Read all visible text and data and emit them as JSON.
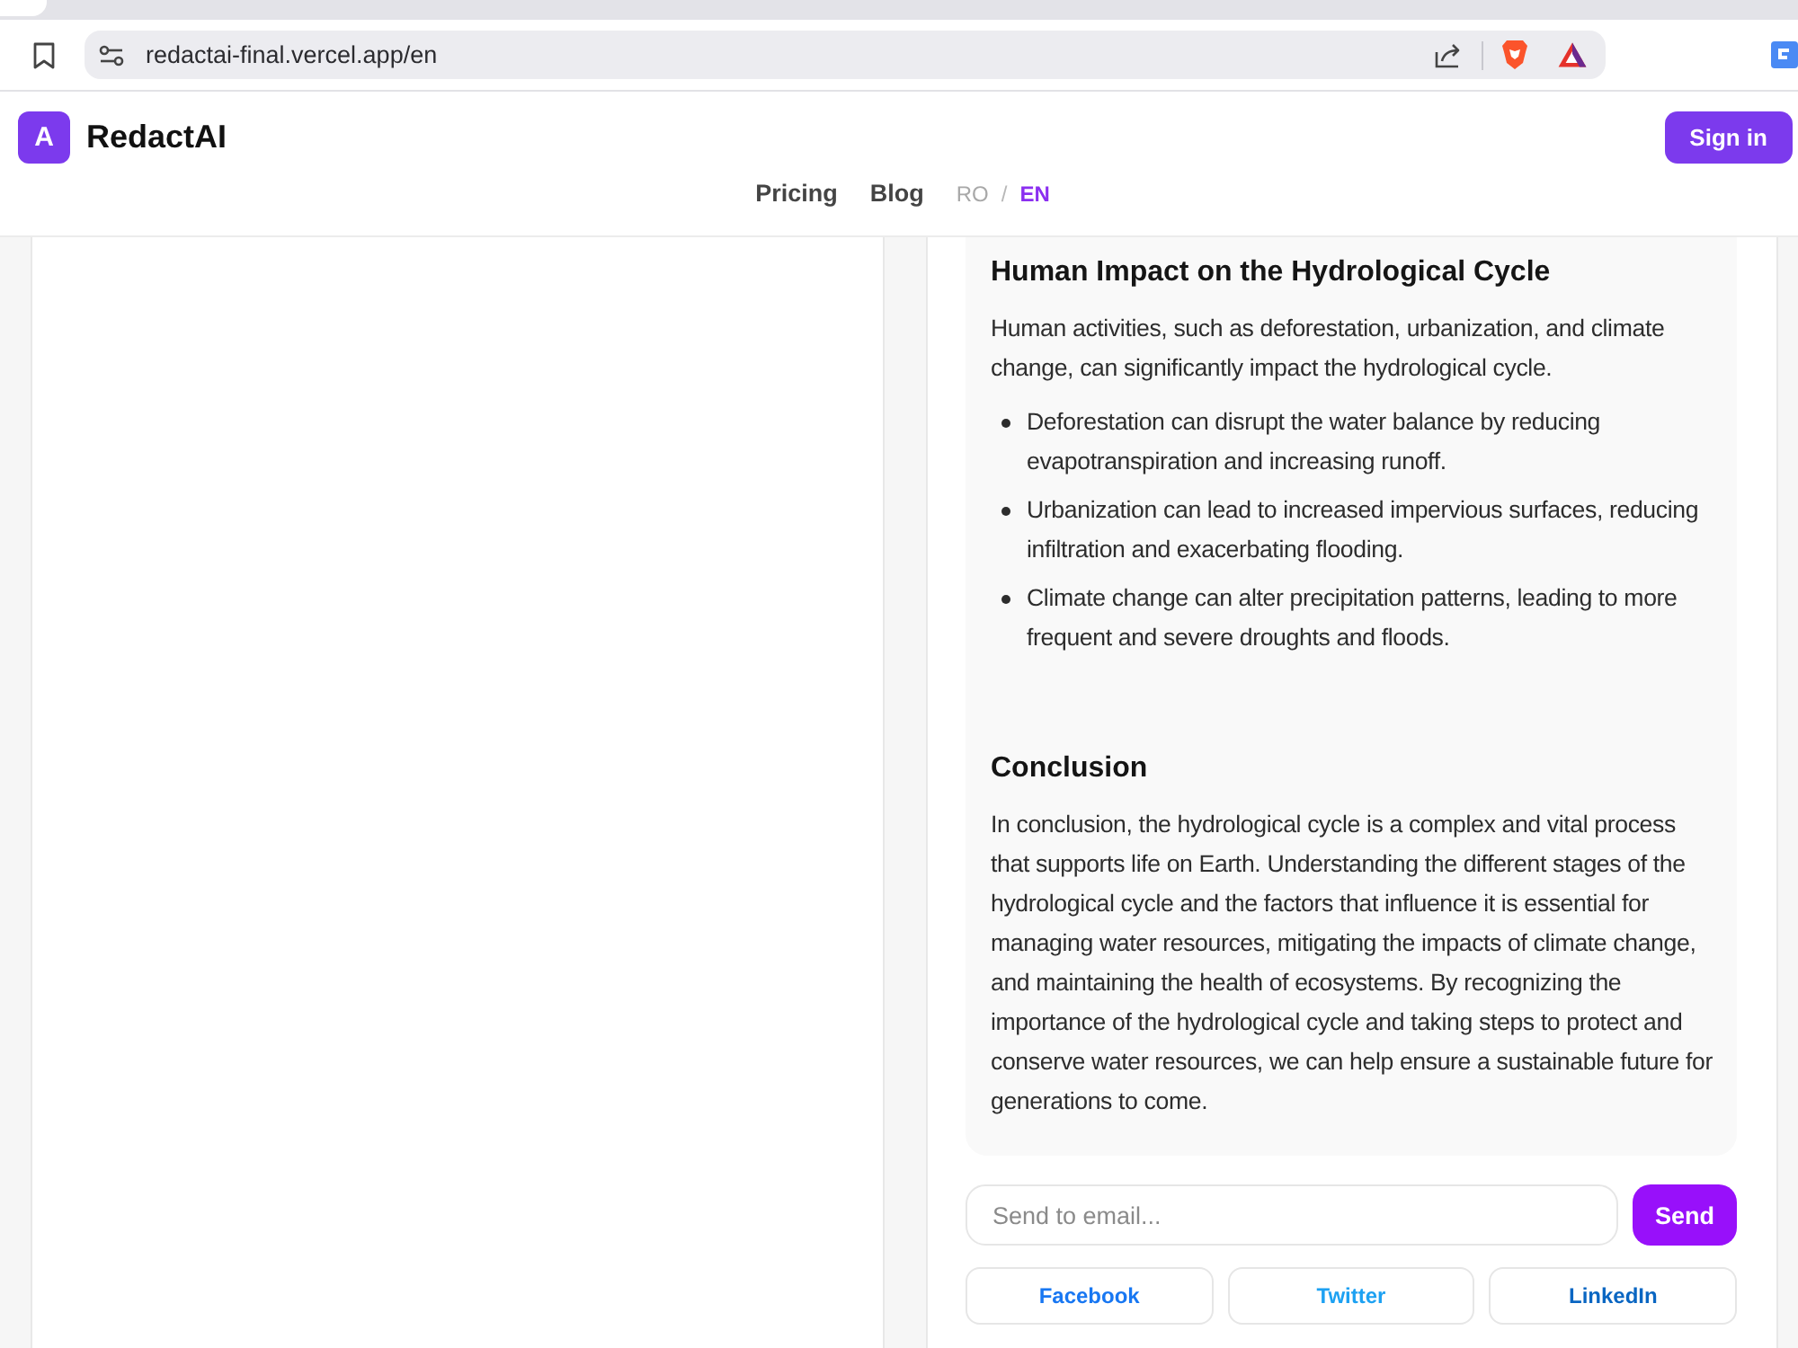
{
  "browser": {
    "url": "redactai-final.vercel.app/en"
  },
  "header": {
    "logo_letter": "A",
    "brand": "RedactAI",
    "sign_in": "Sign in",
    "nav": [
      {
        "label": "Pricing"
      },
      {
        "label": "Blog"
      }
    ],
    "languages": [
      {
        "label": "RO",
        "selected": false
      },
      {
        "label": "EN",
        "selected": true
      }
    ],
    "language_separator": "/"
  },
  "article": {
    "sections": [
      {
        "heading": "Human Impact on the Hydrological Cycle",
        "paragraph": "Human activities, such as deforestation, urbanization, and climate change, can significantly impact the hydrological cycle.",
        "bullets": [
          "Deforestation can disrupt the water balance by reducing evapotranspiration and increasing runoff.",
          "Urbanization can lead to increased impervious surfaces, reducing infiltration and exacerbating flooding.",
          "Climate change can alter precipitation patterns, leading to more frequent and severe droughts and floods."
        ]
      },
      {
        "heading": "Conclusion",
        "paragraph": "In conclusion, the hydrological cycle is a complex and vital process that supports life on Earth. Understanding the different stages of the hydrological cycle and the factors that influence it is essential for managing water resources, mitigating the impacts of climate change, and maintaining the health of ecosystems. By recognizing the importance of the hydrological cycle and taking steps to protect and conserve water resources, we can help ensure a sustainable future for generations to come."
      }
    ]
  },
  "share": {
    "email_placeholder": "Send to email...",
    "send": "Send",
    "social": [
      {
        "label": "Facebook",
        "color": "#1877f2"
      },
      {
        "label": "Twitter",
        "color": "#1da1f2"
      },
      {
        "label": "LinkedIn",
        "color": "#0a66c2"
      }
    ]
  }
}
